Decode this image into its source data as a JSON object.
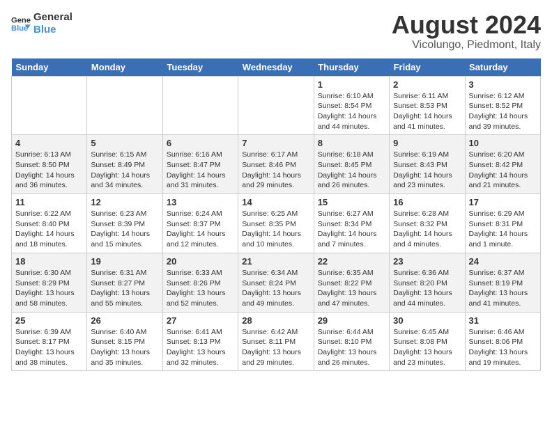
{
  "logo": {
    "line1": "General",
    "line2": "Blue"
  },
  "title": "August 2024",
  "location": "Vicolungo, Piedmont, Italy",
  "days_of_week": [
    "Sunday",
    "Monday",
    "Tuesday",
    "Wednesday",
    "Thursday",
    "Friday",
    "Saturday"
  ],
  "weeks": [
    [
      {
        "day": "",
        "info": ""
      },
      {
        "day": "",
        "info": ""
      },
      {
        "day": "",
        "info": ""
      },
      {
        "day": "",
        "info": ""
      },
      {
        "day": "1",
        "info": "Sunrise: 6:10 AM\nSunset: 8:54 PM\nDaylight: 14 hours and 44 minutes."
      },
      {
        "day": "2",
        "info": "Sunrise: 6:11 AM\nSunset: 8:53 PM\nDaylight: 14 hours and 41 minutes."
      },
      {
        "day": "3",
        "info": "Sunrise: 6:12 AM\nSunset: 8:52 PM\nDaylight: 14 hours and 39 minutes."
      }
    ],
    [
      {
        "day": "4",
        "info": "Sunrise: 6:13 AM\nSunset: 8:50 PM\nDaylight: 14 hours and 36 minutes."
      },
      {
        "day": "5",
        "info": "Sunrise: 6:15 AM\nSunset: 8:49 PM\nDaylight: 14 hours and 34 minutes."
      },
      {
        "day": "6",
        "info": "Sunrise: 6:16 AM\nSunset: 8:47 PM\nDaylight: 14 hours and 31 minutes."
      },
      {
        "day": "7",
        "info": "Sunrise: 6:17 AM\nSunset: 8:46 PM\nDaylight: 14 hours and 29 minutes."
      },
      {
        "day": "8",
        "info": "Sunrise: 6:18 AM\nSunset: 8:45 PM\nDaylight: 14 hours and 26 minutes."
      },
      {
        "day": "9",
        "info": "Sunrise: 6:19 AM\nSunset: 8:43 PM\nDaylight: 14 hours and 23 minutes."
      },
      {
        "day": "10",
        "info": "Sunrise: 6:20 AM\nSunset: 8:42 PM\nDaylight: 14 hours and 21 minutes."
      }
    ],
    [
      {
        "day": "11",
        "info": "Sunrise: 6:22 AM\nSunset: 8:40 PM\nDaylight: 14 hours and 18 minutes."
      },
      {
        "day": "12",
        "info": "Sunrise: 6:23 AM\nSunset: 8:39 PM\nDaylight: 14 hours and 15 minutes."
      },
      {
        "day": "13",
        "info": "Sunrise: 6:24 AM\nSunset: 8:37 PM\nDaylight: 14 hours and 12 minutes."
      },
      {
        "day": "14",
        "info": "Sunrise: 6:25 AM\nSunset: 8:35 PM\nDaylight: 14 hours and 10 minutes."
      },
      {
        "day": "15",
        "info": "Sunrise: 6:27 AM\nSunset: 8:34 PM\nDaylight: 14 hours and 7 minutes."
      },
      {
        "day": "16",
        "info": "Sunrise: 6:28 AM\nSunset: 8:32 PM\nDaylight: 14 hours and 4 minutes."
      },
      {
        "day": "17",
        "info": "Sunrise: 6:29 AM\nSunset: 8:31 PM\nDaylight: 14 hours and 1 minute."
      }
    ],
    [
      {
        "day": "18",
        "info": "Sunrise: 6:30 AM\nSunset: 8:29 PM\nDaylight: 13 hours and 58 minutes."
      },
      {
        "day": "19",
        "info": "Sunrise: 6:31 AM\nSunset: 8:27 PM\nDaylight: 13 hours and 55 minutes."
      },
      {
        "day": "20",
        "info": "Sunrise: 6:33 AM\nSunset: 8:26 PM\nDaylight: 13 hours and 52 minutes."
      },
      {
        "day": "21",
        "info": "Sunrise: 6:34 AM\nSunset: 8:24 PM\nDaylight: 13 hours and 49 minutes."
      },
      {
        "day": "22",
        "info": "Sunrise: 6:35 AM\nSunset: 8:22 PM\nDaylight: 13 hours and 47 minutes."
      },
      {
        "day": "23",
        "info": "Sunrise: 6:36 AM\nSunset: 8:20 PM\nDaylight: 13 hours and 44 minutes."
      },
      {
        "day": "24",
        "info": "Sunrise: 6:37 AM\nSunset: 8:19 PM\nDaylight: 13 hours and 41 minutes."
      }
    ],
    [
      {
        "day": "25",
        "info": "Sunrise: 6:39 AM\nSunset: 8:17 PM\nDaylight: 13 hours and 38 minutes."
      },
      {
        "day": "26",
        "info": "Sunrise: 6:40 AM\nSunset: 8:15 PM\nDaylight: 13 hours and 35 minutes."
      },
      {
        "day": "27",
        "info": "Sunrise: 6:41 AM\nSunset: 8:13 PM\nDaylight: 13 hours and 32 minutes."
      },
      {
        "day": "28",
        "info": "Sunrise: 6:42 AM\nSunset: 8:11 PM\nDaylight: 13 hours and 29 minutes."
      },
      {
        "day": "29",
        "info": "Sunrise: 6:44 AM\nSunset: 8:10 PM\nDaylight: 13 hours and 26 minutes."
      },
      {
        "day": "30",
        "info": "Sunrise: 6:45 AM\nSunset: 8:08 PM\nDaylight: 13 hours and 23 minutes."
      },
      {
        "day": "31",
        "info": "Sunrise: 6:46 AM\nSunset: 8:06 PM\nDaylight: 13 hours and 19 minutes."
      }
    ]
  ]
}
